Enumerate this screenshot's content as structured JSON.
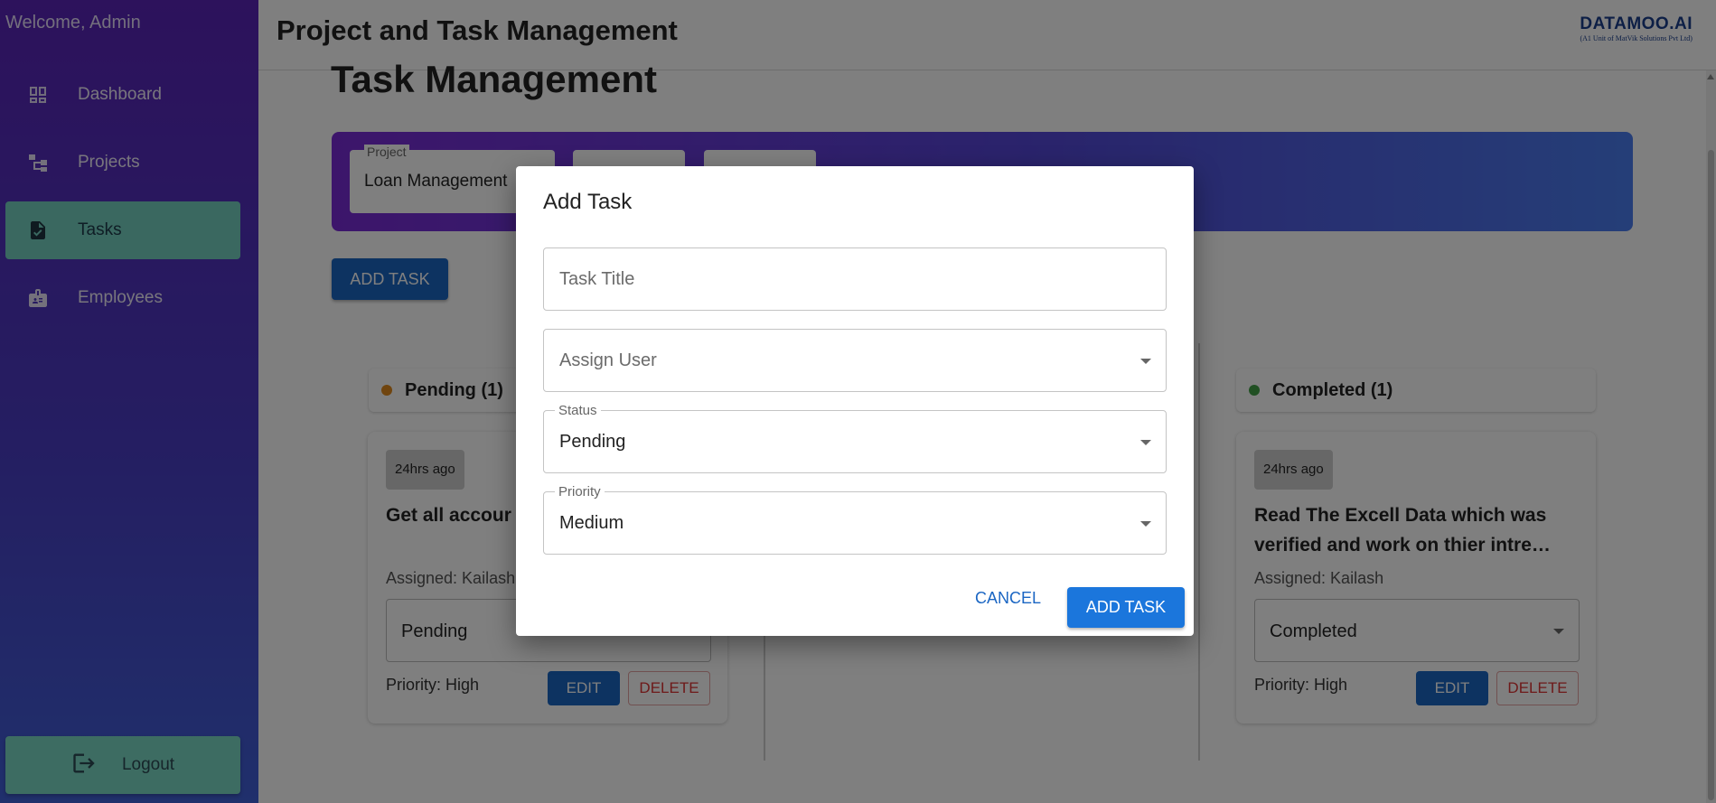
{
  "sidebar": {
    "welcome": "Welcome, Admin",
    "items": [
      {
        "label": "Dashboard",
        "icon": "dashboard-icon"
      },
      {
        "label": "Projects",
        "icon": "project-tree-icon"
      },
      {
        "label": "Tasks",
        "icon": "task-document-icon",
        "active": true
      },
      {
        "label": "Employees",
        "icon": "employee-badge-icon"
      }
    ],
    "logout": "Logout"
  },
  "header": {
    "title": "Project and Task Management",
    "logo_brand": "DATAMOO.AI",
    "logo_sub": "(A1 Unit of MatVik Solutions Pvt Ltd)"
  },
  "main": {
    "heading": "Task Management",
    "filter": {
      "project_label": "Project",
      "project_value": "Loan Management"
    },
    "add_task_label": "ADD TASK",
    "columns": [
      {
        "label": "Pending (1)",
        "dot_color": "#e08a1e"
      },
      {
        "label": "Completed (1)",
        "dot_color": "#43a047"
      }
    ],
    "cards": [
      {
        "time": "24hrs ago",
        "title": "Get all accour customer and",
        "assigned": "Assigned: Kailash",
        "status": "Pending",
        "priority": "Priority: High",
        "edit": "EDIT",
        "delete": "DELETE"
      },
      {
        "time": "24hrs ago",
        "title": "Read The Excell Data which was verified and work on thier intre…",
        "assigned": "Assigned: Kailash",
        "status": "Completed",
        "priority": "Priority: High",
        "edit": "EDIT",
        "delete": "DELETE"
      }
    ]
  },
  "dialog": {
    "title": "Add Task",
    "task_title_placeholder": "Task Title",
    "assign_user_placeholder": "Assign User",
    "status_label": "Status",
    "status_value": "Pending",
    "priority_label": "Priority",
    "priority_value": "Medium",
    "cancel": "CANCEL",
    "submit": "ADD TASK"
  }
}
